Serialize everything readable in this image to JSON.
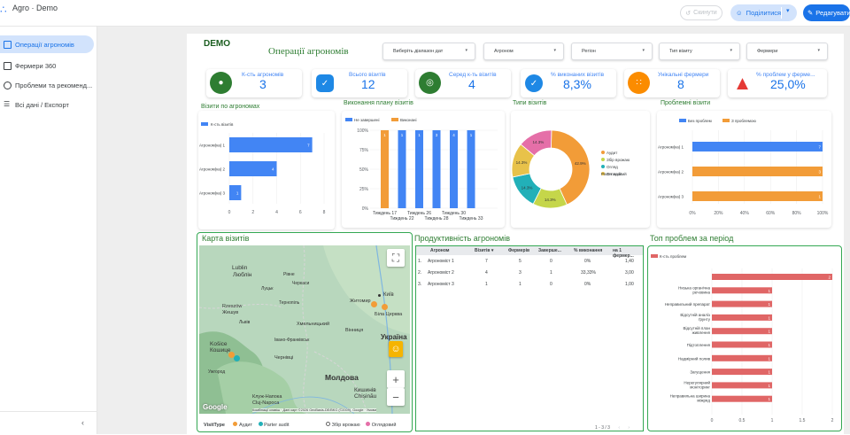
{
  "app": {
    "title": "Agro · Demo",
    "undo_label": "Скинути",
    "share_label": "Поділитися",
    "edit_label": "Редагувати"
  },
  "sidebar": {
    "items": [
      {
        "label": "Операції агрономів",
        "icon": "document-icon",
        "active": true
      },
      {
        "label": "Фермери 360",
        "icon": "chart-icon",
        "active": false
      },
      {
        "label": "Проблеми та рекоменд...",
        "icon": "check-circle-icon",
        "active": false
      },
      {
        "label": "Всі дані / Експорт",
        "icon": "list-icon",
        "active": false
      }
    ]
  },
  "report": {
    "demo_label": "DEMO",
    "title": "Операції агрономів",
    "filters": [
      "Виберіть діапазон дат",
      "Агроном",
      "Регіон",
      "Тип візиту",
      "Фермери"
    ]
  },
  "kpis": [
    {
      "label": "К-сть агрономів",
      "value": "3",
      "color": "#2e7d32",
      "icon": "person-icon"
    },
    {
      "label": "Всього візитів",
      "value": "12",
      "color": "#1e88e5",
      "icon": "clipboard-icon"
    },
    {
      "label": "Серед к-ть візитів",
      "value": "4",
      "color": "#2e7d32",
      "icon": "target-icon"
    },
    {
      "label": "% виконаних візитів",
      "value": "8,3%",
      "color": "#1e88e5",
      "icon": "check-badge-icon"
    },
    {
      "label": "Унікальні фермери",
      "value": "8",
      "color": "#fb8c00",
      "icon": "group-icon"
    },
    {
      "label": "% проблем у ферме...",
      "value": "25,0%",
      "color": "#e53935",
      "icon": "warning-icon"
    }
  ],
  "sections": {
    "visits_by_agronomist": "Візити по агрономах",
    "plan_completion": "Виконання плану візитів",
    "visit_types": "Типи візитів",
    "problem_visits": "Проблемні візити",
    "map": "Карта візитів",
    "productivity": "Продуктивність агрономів",
    "top_problems": "Топ проблем за період"
  },
  "chart_data": [
    {
      "type": "bar",
      "orientation": "horizontal",
      "title": "Візити по агрономах",
      "categories": [
        "Агроном(ка) 1",
        "Агроном(ка) 2",
        "Агроном(ка) 3"
      ],
      "series": [
        {
          "name": "К-сть візитів",
          "values": [
            7,
            4,
            1
          ],
          "color": "#4285f4"
        }
      ],
      "xticks": [
        "0",
        "2",
        "4",
        "6",
        "8"
      ],
      "xlim": [
        0,
        8
      ],
      "legend": "top-left"
    },
    {
      "type": "bar",
      "stacked": true,
      "title": "Виконання плану візитів",
      "categories": [
        "Тиждень 17",
        "Тиждень 22",
        "Тиждень 26",
        "Тиждень 28",
        "Тиждень 30",
        "Тиждень 33"
      ],
      "series": [
        {
          "name": "Не завершені",
          "values": [
            0,
            1,
            1,
            1,
            1,
            1
          ],
          "color": "#4285f4"
        },
        {
          "name": "Виконані",
          "values": [
            1,
            0,
            0,
            0,
            0,
            0
          ],
          "color": "#f29c38"
        }
      ],
      "yticks": [
        "0%",
        "25%",
        "50%",
        "75%",
        "100%"
      ],
      "data_labels": [
        "1",
        "1",
        "1",
        "3",
        "4",
        "1"
      ],
      "legend": "top-left"
    },
    {
      "type": "pie",
      "donut": true,
      "title": "Типи візитів",
      "labels": [
        "Аудит",
        "Збір врожаю",
        "Огляд",
        "Огляд полів",
        "Оглядовий"
      ],
      "values": [
        42.9,
        14.3,
        14.3,
        14.3,
        14.3
      ],
      "label_text": [
        "42.9%",
        "14.3%",
        "14.3%",
        "14.3%",
        "14.3%"
      ],
      "colors": [
        "#f29c38",
        "#c5d64a",
        "#22b0b8",
        "#e8c24a",
        "#e56fa8"
      ],
      "legend_labels": [
        "Аудит",
        "Збір врожаю",
        "Огляд",
        "Оглядовий"
      ],
      "legend": "right"
    },
    {
      "type": "bar",
      "orientation": "horizontal",
      "stacked": true,
      "percent": true,
      "title": "Проблемні візити",
      "categories": [
        "Агроном(ка) 1",
        "Агроном(ка) 2",
        "Агроном(ка) 3"
      ],
      "series": [
        {
          "name": "Без проблем",
          "values": [
            7,
            0,
            0
          ],
          "color": "#4285f4"
        },
        {
          "name": "З проблемою",
          "values": [
            0,
            3,
            1
          ],
          "color": "#f29c38"
        }
      ],
      "data_labels": [
        "7",
        "3",
        "1"
      ],
      "xticks": [
        "0%",
        "20%",
        "40%",
        "60%",
        "80%",
        "100%"
      ],
      "legend": "top-left"
    },
    {
      "type": "bar",
      "orientation": "horizontal",
      "title": "Топ проблем за період",
      "categories": [
        "",
        "Низька органічна речовина",
        "Неправильний препарат",
        "Відсутній аналіз ґрунту",
        "Відсутній план живлення",
        "Підтоплення",
        "Надмірний полив",
        "Загущення",
        "Нерегулярний моніторинг",
        "Неправильна ширина міжряд"
      ],
      "series": [
        {
          "name": "К-сть проблем",
          "values": [
            2,
            1,
            1,
            1,
            1,
            1,
            1,
            1,
            1,
            1
          ],
          "color": "#e06666"
        }
      ],
      "data_labels": [
        "2",
        "1",
        "1",
        "1",
        "1",
        "1",
        "1",
        "1",
        "1",
        "1"
      ],
      "xticks": [
        "0",
        "0.5",
        "1",
        "1.5",
        "2"
      ],
      "xlim": [
        0,
        2
      ],
      "legend": "top-left"
    }
  ],
  "map": {
    "cities": [
      "Lublin",
      "Люблін",
      "Rzeszów",
      "Жешув",
      "Київ",
      "Житомир",
      "Біла Церква",
      "Україна",
      "Хмельницький",
      "Вінниця",
      "Košice",
      "Кошице",
      "Чернівці",
      "Молдова",
      "Кишинів",
      "Chișinău",
      "Клуж-Напока",
      "Cluj-Napoca",
      "Черкаси",
      "Тернопіль",
      "Івано-Франківськ",
      "Львів",
      "Луцьк",
      "Ужгород",
      "Рівне"
    ],
    "google_label": "Google",
    "attribution": "Комбінації клавіш · Дані карт ©2026 GeoBasis-DE/BKG (©2009), Google · Умови",
    "legend_title": "VisitType",
    "legend_items": [
      "Аудит",
      "Parter audit",
      "Збір врожаю",
      "Оглядовий"
    ]
  },
  "productivity_table": {
    "columns": [
      "Агроном",
      "Візитів ▾",
      "Фермерів",
      "Заверше...",
      "% виконання",
      "на 1 фермер..."
    ],
    "rows": [
      [
        "1.",
        "Агрономіст 1",
        "7",
        "5",
        "0",
        "0%",
        "1,40"
      ],
      [
        "2.",
        "Агрономіст 2",
        "4",
        "3",
        "1",
        "33,33%",
        "3,00"
      ],
      [
        "3.",
        "Агрономіст 3",
        "1",
        "1",
        "0",
        "0%",
        "1,00"
      ]
    ],
    "pager": "1 - 3 / 3"
  }
}
